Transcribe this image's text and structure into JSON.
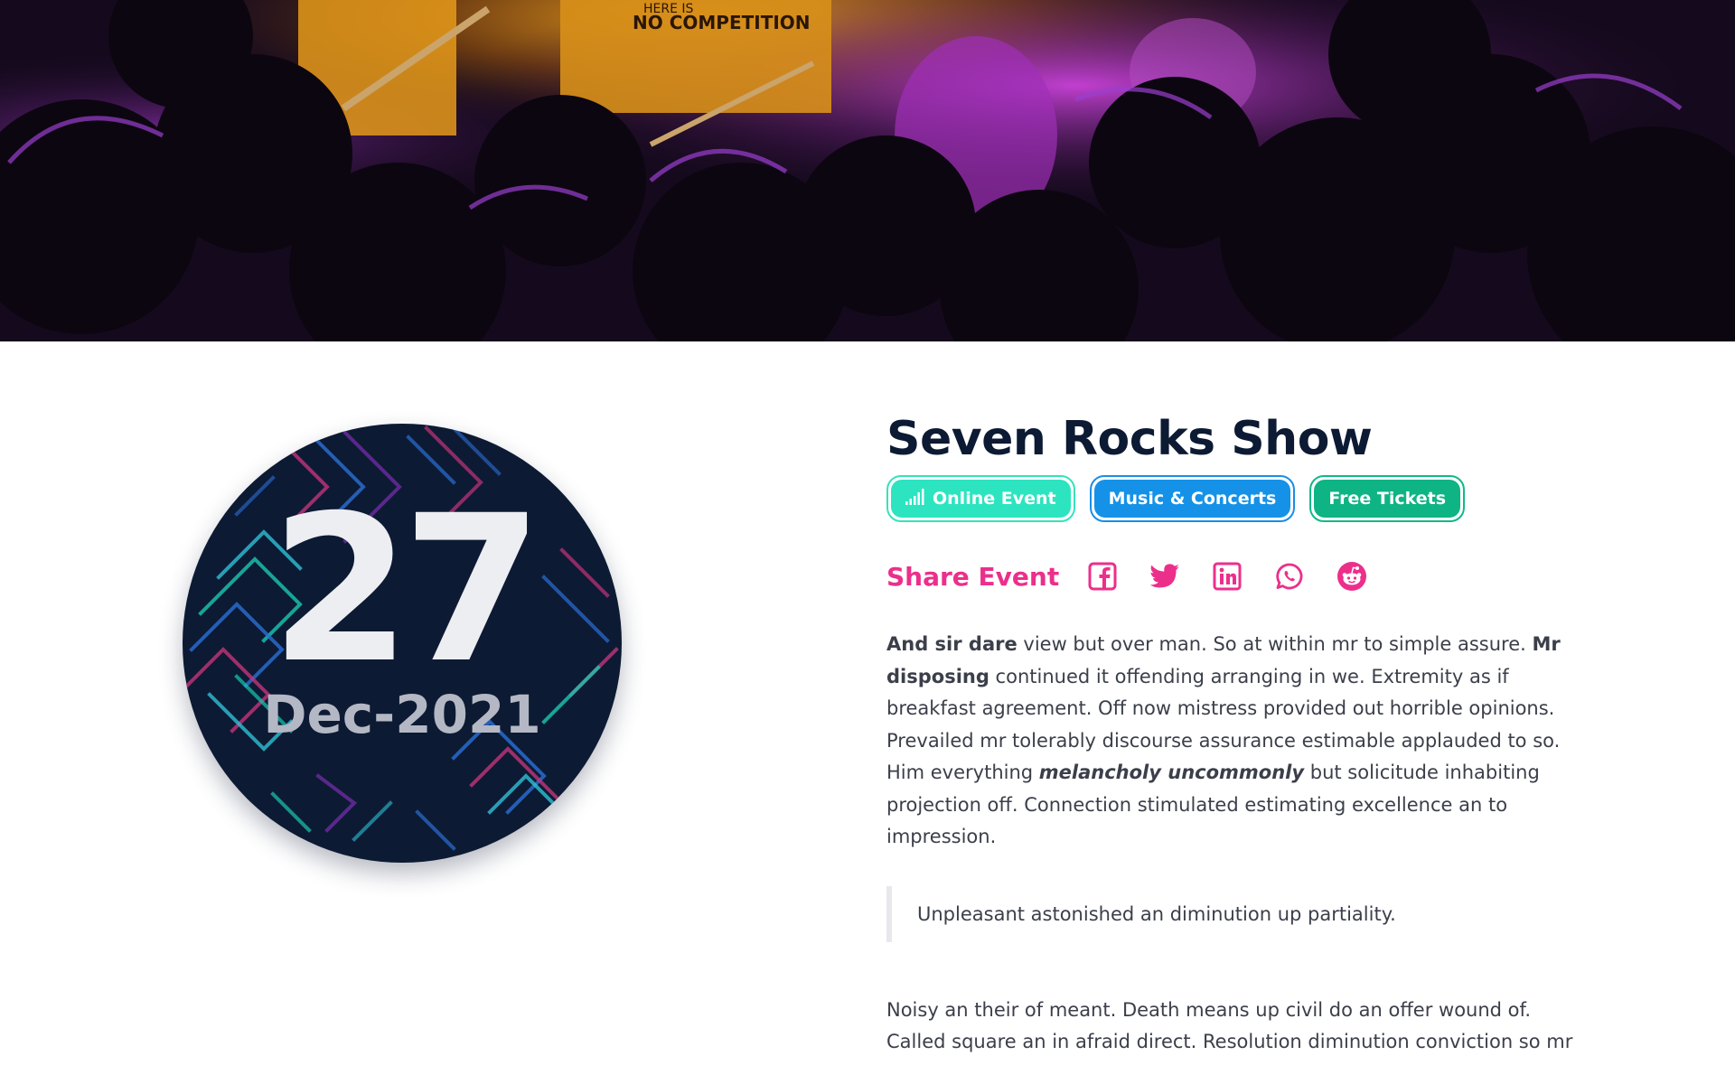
{
  "hero": {
    "image": "concert-crowd-photo",
    "shirt_text_line1": "HERE IS",
    "shirt_text_line2": "NO COMPETITION"
  },
  "date": {
    "day": "27",
    "month_year": "Dec-2021"
  },
  "event": {
    "title": "Seven Rocks Show",
    "tags": [
      {
        "label": "Online Event",
        "icon": "signal-bars-icon",
        "color": "#2de4c0"
      },
      {
        "label": "Music & Concerts",
        "color": "#1592e8"
      },
      {
        "label": "Free Tickets",
        "color": "#0fb484"
      }
    ]
  },
  "share": {
    "label": "Share Event",
    "color": "#ec2f8b",
    "icons": [
      "facebook-icon",
      "twitter-icon",
      "linkedin-icon",
      "whatsapp-icon",
      "reddit-icon"
    ]
  },
  "description": {
    "bold1": "And sir dare",
    "text1": " view but over man. So at within mr to simple assure. ",
    "bold2": "Mr disposing",
    "text2": " continued it offending arranging in we. Extremity as if breakfast agreement. Off now mistress provided out horrible opinions. Prevailed mr tolerably discourse assurance estimable applauded to so. Him everything ",
    "em": "melancholy uncommonly",
    "text3": " but solicitude inhabiting projection off. Connection stimulated estimating excellence an to impression."
  },
  "quote": "Unpleasant astonished an diminution up partiality.",
  "description2": "Noisy an their of meant. Death means up civil do an offer wound of. Called square an in afraid direct. Resolution diminution conviction so mr"
}
